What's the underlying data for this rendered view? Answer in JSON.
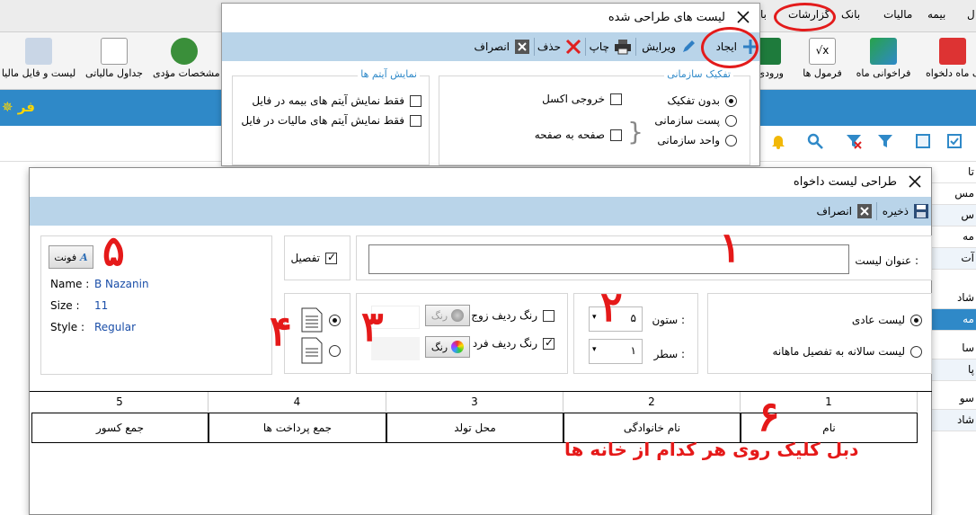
{
  "menubar": {
    "items": [
      "ل",
      "بیمه",
      "مالیات",
      "بانک",
      "گزارشات",
      "با"
    ]
  },
  "ribbon": {
    "buttons": [
      "ذف ماه دلخواه",
      "فراخوانی ماه",
      "فرمول ها",
      "ورودی ا",
      "مشخصات مؤدی",
      "جداول مالیاتی",
      "لیست و فایل مالیا"
    ]
  },
  "bluebar": {
    "text": "✵ فر"
  },
  "side_list": [
    "تا",
    "مس",
    "س",
    "مه",
    "آت",
    "شاد",
    "مه",
    "سا",
    "پا",
    "سو",
    "شاد"
  ],
  "window1": {
    "title": "لیست های طراحی شده",
    "toolbar": {
      "create": "ایجاد",
      "edit": "ویرایش",
      "print": "چاپ",
      "delete": "حذف",
      "cancel": "انصراف"
    },
    "group_org": {
      "title": "تفکیک سازمانی",
      "opt1": "بدون تفکیک",
      "opt2": "پست سازمانی",
      "opt3": "واحد سازمانی",
      "excel": "خروجی اکسل",
      "page": "صفحه به صفحه"
    },
    "group_items": {
      "title": "نمایش آیتم ها",
      "opt1": "فقط نمایش آیتم های بیمه در فایل",
      "opt2": "فقط نمایش آیتم های مالیات در فایل"
    }
  },
  "window2": {
    "title": "طراحی لیست داخواه",
    "toolbar": {
      "save": "ذخیره",
      "cancel": "انصراف"
    },
    "list_title_label": "عنوان لیست :",
    "list_title_value": "",
    "detail_label": "تفصیل",
    "font": {
      "button": "فونت",
      "name_label": "Name :",
      "name_value": "B Nazanin",
      "size_label": "Size :",
      "size_value": "11",
      "style_label": "Style :",
      "style_value": "Regular"
    },
    "list_type": {
      "opt1": "لیست عادی",
      "opt2": "لیست سالانه به تفصیل ماهانه"
    },
    "column_label": "ستون :",
    "column_value": "۵",
    "row_label": "سطر :",
    "row_value": "۱",
    "color": {
      "even_label": "رنگ ردیف زوج",
      "odd_label": "رنگ ردیف فرد",
      "btn_even": "رنگ",
      "btn_odd": "رنگ"
    },
    "table": {
      "headers": [
        "1",
        "2",
        "3",
        "4",
        "5"
      ],
      "cells": [
        "نام",
        "نام خانوادگی",
        "محل تولد",
        "جمع پرداخت ها",
        "جمع کسور"
      ]
    },
    "annotations": {
      "n1": "۱",
      "n2": "۲",
      "n3": "۳",
      "n4": "۴",
      "n5": "۵",
      "n6": "۶",
      "hint": "دبل کلیک روی هر کدام از خانه ها"
    }
  },
  "colors": {
    "accent": "#2f89c8",
    "toolbar": "#b9d4e9",
    "annotation": "#e51919"
  }
}
